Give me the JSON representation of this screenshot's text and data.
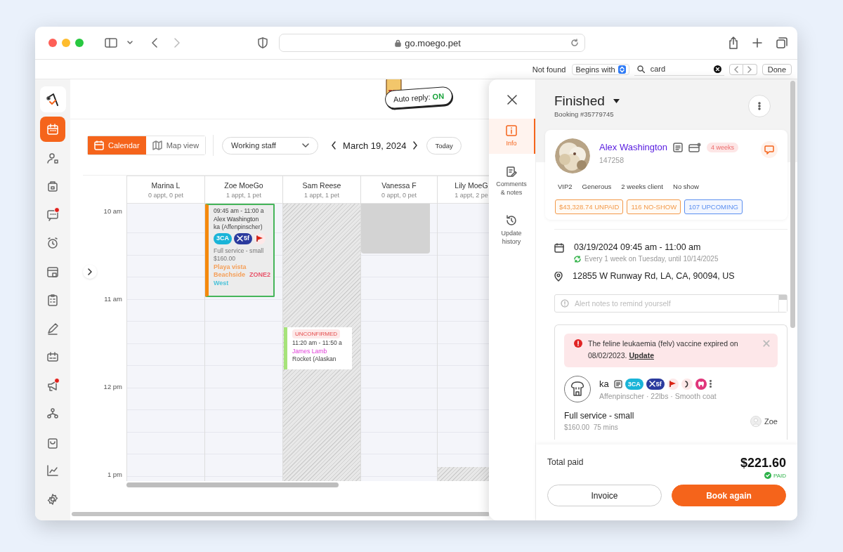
{
  "browser": {
    "url": "go.moego.pet"
  },
  "find_bar": {
    "status": "Not found",
    "mode": "Begins with",
    "query": "card",
    "done": "Done"
  },
  "nav": {
    "items": [
      {
        "selected": true,
        "badge": false
      },
      {
        "selected": false,
        "badge": false
      },
      {
        "selected": false,
        "badge": false
      },
      {
        "selected": false,
        "badge": true
      },
      {
        "selected": false,
        "badge": false
      },
      {
        "selected": false,
        "badge": false
      },
      {
        "selected": false,
        "badge": false
      },
      {
        "selected": false,
        "badge": false
      },
      {
        "selected": false,
        "badge": false
      },
      {
        "selected": false,
        "badge": true
      },
      {
        "selected": false,
        "badge": false
      },
      {
        "selected": false,
        "badge": false
      },
      {
        "selected": false,
        "badge": false
      },
      {
        "selected": false,
        "badge": false
      }
    ]
  },
  "header": {
    "auto_reply_label": "Auto reply:",
    "auto_reply_state": "ON"
  },
  "view_tabs": [
    {
      "label": "Calendar",
      "selected": true
    },
    {
      "label": "Map view",
      "selected": false
    }
  ],
  "staff_filter": "Working staff",
  "date": "March 19, 2024",
  "today": "Today",
  "time_labels": [
    "10 am",
    "11 am",
    "12 pm",
    "1 pm"
  ],
  "staff": [
    {
      "name": "Marina L",
      "summary": "0 appt, 0 pet",
      "unavailable": false
    },
    {
      "name": "Zoe MoeGo",
      "summary": "1 appt, 1 pet",
      "unavailable": false,
      "events": [
        {
          "kind": "appointment",
          "selected": true,
          "color": "#f5890d",
          "time": "09:45 am - 11:00 a",
          "client": "Alex Washington",
          "pet": "ka (Affenpinscher)",
          "tags": [
            {
              "kind": "code",
              "label": "3CA",
              "color": "#19b4d8"
            },
            {
              "kind": "groomer",
              "label": "5f",
              "color": "#2b3b9e"
            },
            {
              "kind": "flag"
            }
          ],
          "service": "Full service - small",
          "price": "$160.00",
          "zones": [
            {
              "label": "Playa vista",
              "color": "#f5a05a"
            },
            {
              "label": "Beachside",
              "color": "#f5a05a"
            },
            {
              "label": "ZONE2",
              "color": "#e8566c"
            },
            {
              "label": "West",
              "color": "#4cc3d9"
            }
          ]
        }
      ]
    },
    {
      "name": "Sam Reese",
      "summary": "1 appt, 1 pet",
      "unavailable": true,
      "events": [
        {
          "kind": "appointment",
          "selected": false,
          "color": "#a6e37a",
          "status": "UNCONFIRMED",
          "time": "11:20 am - 11:50 a",
          "client": "James Lamb",
          "pet": "Rocket (Alaskan"
        }
      ]
    },
    {
      "name": "Vanessa F",
      "summary": "0 appt, 0 pet",
      "unavailable": false,
      "events": [
        {
          "kind": "blocked"
        }
      ]
    },
    {
      "name": "Lily MoeG",
      "summary": "1 appt, 2 pe",
      "unavailable": false,
      "events": [
        {
          "kind": "unavailable"
        }
      ]
    }
  ],
  "drawer": {
    "rail": [
      {
        "label": "Info",
        "selected": true
      },
      {
        "label": "Comments & notes",
        "selected": false
      },
      {
        "label": "Update history",
        "selected": false
      }
    ],
    "status": "Finished",
    "booking": "Booking #35779745",
    "client": {
      "name": "Alex Washington",
      "id": "147258",
      "frequency": "4 weeks",
      "tags": [
        "VIP2",
        "Generous",
        "2 weeks client",
        "No show"
      ],
      "badges": [
        {
          "label": "$43,328.74 UNPAID",
          "color": "#f39a4a"
        },
        {
          "label": "116 NO-SHOW",
          "color": "#f39a4a"
        },
        {
          "label": "107 UPCOMING",
          "color": "#5b8ff0"
        }
      ]
    },
    "date": "03/19/2024",
    "time": "09:45 am - 11:00 am",
    "recurrence": "Every 1 week on Tuesday, until 10/14/2025",
    "address": "12855 W Runway Rd, LA, CA, 90094, US",
    "alert_placeholder": "Alert notes to remind yourself",
    "vaccine_alert": "The feline leukaemia (felv) vaccine expired on 08/02/2023.",
    "vaccine_link": "Update",
    "pet": {
      "name": "ka",
      "tags": [
        {
          "kind": "code",
          "label": "3CA",
          "color": "#19b4d8"
        },
        {
          "kind": "groomer",
          "label": "5f",
          "color": "#2b3b9e"
        },
        {
          "kind": "flag"
        },
        {
          "kind": "crescent"
        },
        {
          "kind": "tooth"
        }
      ],
      "details": "Affenpinscher · 22lbs · Smooth coat"
    },
    "service": {
      "name": "Full service - small",
      "price": "$160.00",
      "duration": "75 mins",
      "staff": "Zoe"
    },
    "total_label": "Total paid",
    "total": "$221.60",
    "payment_status": "PAID",
    "buttons": [
      {
        "kind": "secondary",
        "label": "Invoice"
      },
      {
        "kind": "primary",
        "label": "Book again"
      }
    ]
  }
}
